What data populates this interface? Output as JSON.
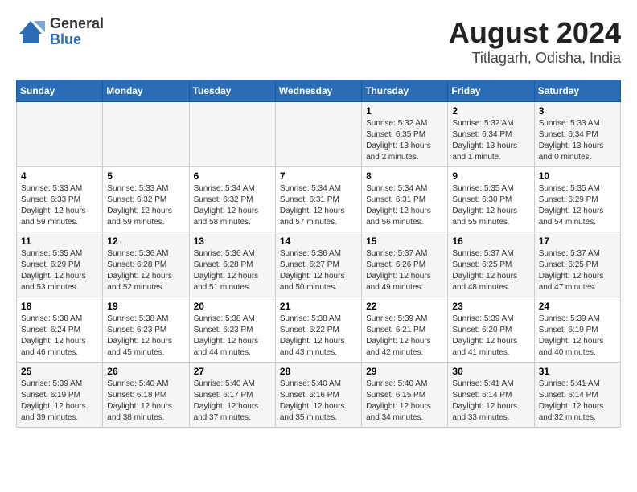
{
  "header": {
    "logo_general": "General",
    "logo_blue": "Blue",
    "title": "August 2024",
    "subtitle": "Titlagarh, Odisha, India"
  },
  "days_of_week": [
    "Sunday",
    "Monday",
    "Tuesday",
    "Wednesday",
    "Thursday",
    "Friday",
    "Saturday"
  ],
  "weeks": [
    [
      {
        "day": "",
        "detail": ""
      },
      {
        "day": "",
        "detail": ""
      },
      {
        "day": "",
        "detail": ""
      },
      {
        "day": "",
        "detail": ""
      },
      {
        "day": "1",
        "detail": "Sunrise: 5:32 AM\nSunset: 6:35 PM\nDaylight: 13 hours\nand 2 minutes."
      },
      {
        "day": "2",
        "detail": "Sunrise: 5:32 AM\nSunset: 6:34 PM\nDaylight: 13 hours\nand 1 minute."
      },
      {
        "day": "3",
        "detail": "Sunrise: 5:33 AM\nSunset: 6:34 PM\nDaylight: 13 hours\nand 0 minutes."
      }
    ],
    [
      {
        "day": "4",
        "detail": "Sunrise: 5:33 AM\nSunset: 6:33 PM\nDaylight: 12 hours\nand 59 minutes."
      },
      {
        "day": "5",
        "detail": "Sunrise: 5:33 AM\nSunset: 6:32 PM\nDaylight: 12 hours\nand 59 minutes."
      },
      {
        "day": "6",
        "detail": "Sunrise: 5:34 AM\nSunset: 6:32 PM\nDaylight: 12 hours\nand 58 minutes."
      },
      {
        "day": "7",
        "detail": "Sunrise: 5:34 AM\nSunset: 6:31 PM\nDaylight: 12 hours\nand 57 minutes."
      },
      {
        "day": "8",
        "detail": "Sunrise: 5:34 AM\nSunset: 6:31 PM\nDaylight: 12 hours\nand 56 minutes."
      },
      {
        "day": "9",
        "detail": "Sunrise: 5:35 AM\nSunset: 6:30 PM\nDaylight: 12 hours\nand 55 minutes."
      },
      {
        "day": "10",
        "detail": "Sunrise: 5:35 AM\nSunset: 6:29 PM\nDaylight: 12 hours\nand 54 minutes."
      }
    ],
    [
      {
        "day": "11",
        "detail": "Sunrise: 5:35 AM\nSunset: 6:29 PM\nDaylight: 12 hours\nand 53 minutes."
      },
      {
        "day": "12",
        "detail": "Sunrise: 5:36 AM\nSunset: 6:28 PM\nDaylight: 12 hours\nand 52 minutes."
      },
      {
        "day": "13",
        "detail": "Sunrise: 5:36 AM\nSunset: 6:28 PM\nDaylight: 12 hours\nand 51 minutes."
      },
      {
        "day": "14",
        "detail": "Sunrise: 5:36 AM\nSunset: 6:27 PM\nDaylight: 12 hours\nand 50 minutes."
      },
      {
        "day": "15",
        "detail": "Sunrise: 5:37 AM\nSunset: 6:26 PM\nDaylight: 12 hours\nand 49 minutes."
      },
      {
        "day": "16",
        "detail": "Sunrise: 5:37 AM\nSunset: 6:25 PM\nDaylight: 12 hours\nand 48 minutes."
      },
      {
        "day": "17",
        "detail": "Sunrise: 5:37 AM\nSunset: 6:25 PM\nDaylight: 12 hours\nand 47 minutes."
      }
    ],
    [
      {
        "day": "18",
        "detail": "Sunrise: 5:38 AM\nSunset: 6:24 PM\nDaylight: 12 hours\nand 46 minutes."
      },
      {
        "day": "19",
        "detail": "Sunrise: 5:38 AM\nSunset: 6:23 PM\nDaylight: 12 hours\nand 45 minutes."
      },
      {
        "day": "20",
        "detail": "Sunrise: 5:38 AM\nSunset: 6:23 PM\nDaylight: 12 hours\nand 44 minutes."
      },
      {
        "day": "21",
        "detail": "Sunrise: 5:38 AM\nSunset: 6:22 PM\nDaylight: 12 hours\nand 43 minutes."
      },
      {
        "day": "22",
        "detail": "Sunrise: 5:39 AM\nSunset: 6:21 PM\nDaylight: 12 hours\nand 42 minutes."
      },
      {
        "day": "23",
        "detail": "Sunrise: 5:39 AM\nSunset: 6:20 PM\nDaylight: 12 hours\nand 41 minutes."
      },
      {
        "day": "24",
        "detail": "Sunrise: 5:39 AM\nSunset: 6:19 PM\nDaylight: 12 hours\nand 40 minutes."
      }
    ],
    [
      {
        "day": "25",
        "detail": "Sunrise: 5:39 AM\nSunset: 6:19 PM\nDaylight: 12 hours\nand 39 minutes."
      },
      {
        "day": "26",
        "detail": "Sunrise: 5:40 AM\nSunset: 6:18 PM\nDaylight: 12 hours\nand 38 minutes."
      },
      {
        "day": "27",
        "detail": "Sunrise: 5:40 AM\nSunset: 6:17 PM\nDaylight: 12 hours\nand 37 minutes."
      },
      {
        "day": "28",
        "detail": "Sunrise: 5:40 AM\nSunset: 6:16 PM\nDaylight: 12 hours\nand 35 minutes."
      },
      {
        "day": "29",
        "detail": "Sunrise: 5:40 AM\nSunset: 6:15 PM\nDaylight: 12 hours\nand 34 minutes."
      },
      {
        "day": "30",
        "detail": "Sunrise: 5:41 AM\nSunset: 6:14 PM\nDaylight: 12 hours\nand 33 minutes."
      },
      {
        "day": "31",
        "detail": "Sunrise: 5:41 AM\nSunset: 6:14 PM\nDaylight: 12 hours\nand 32 minutes."
      }
    ]
  ]
}
